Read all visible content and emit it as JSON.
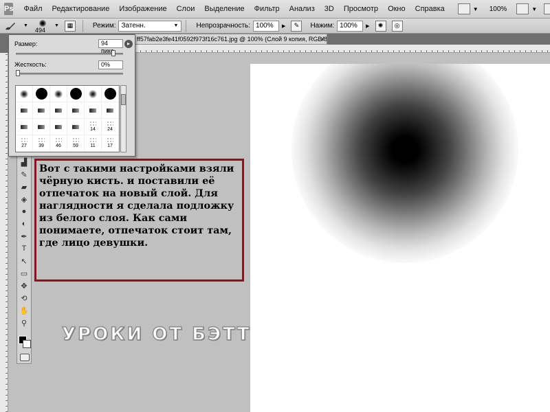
{
  "menubar": {
    "logo": "Ps",
    "items": [
      "Файл",
      "Редактирование",
      "Изображение",
      "Слои",
      "Выделение",
      "Фильтр",
      "Анализ",
      "3D",
      "Просмотр",
      "Окно",
      "Справка"
    ],
    "zoom_1": "100%",
    "zoom_2": "100%"
  },
  "options": {
    "brush_size": "494",
    "mode_label": "Режим:",
    "mode_value": "Затенн.",
    "opacity_label": "Непрозрачность:",
    "opacity_value": "100%",
    "flow_label": "Нажим:",
    "flow_value": "100%"
  },
  "document": {
    "tab_title": "ff57fab2e3fe41f0592f973f16c761.jpg @ 100% (Слой 9 копия, RGB/8)",
    "tab_close": "×"
  },
  "brush_popup": {
    "size_label": "Размер:",
    "size_value": "94 пикс.",
    "size_fraction": 0.94,
    "hardness_label": "Жесткость:",
    "hardness_value": "0%",
    "hardness_fraction": 0.0,
    "presets": [
      {
        "kind": "soft",
        "label": ""
      },
      {
        "kind": "hard",
        "label": ""
      },
      {
        "kind": "soft",
        "label": ""
      },
      {
        "kind": "hard",
        "label": ""
      },
      {
        "kind": "soft",
        "label": ""
      },
      {
        "kind": "hard",
        "label": ""
      },
      {
        "kind": "small",
        "label": ""
      },
      {
        "kind": "small",
        "label": ""
      },
      {
        "kind": "small",
        "label": ""
      },
      {
        "kind": "small",
        "label": ""
      },
      {
        "kind": "small",
        "label": ""
      },
      {
        "kind": "small",
        "label": ""
      },
      {
        "kind": "small",
        "label": ""
      },
      {
        "kind": "small",
        "label": ""
      },
      {
        "kind": "small",
        "label": ""
      },
      {
        "kind": "small",
        "label": ""
      },
      {
        "kind": "splat",
        "label": "14"
      },
      {
        "kind": "splat",
        "label": "24"
      },
      {
        "kind": "splat",
        "label": "27"
      },
      {
        "kind": "splat",
        "label": "39"
      },
      {
        "kind": "splat",
        "label": "46"
      },
      {
        "kind": "splat",
        "label": "59"
      },
      {
        "kind": "splat",
        "label": "11"
      },
      {
        "kind": "splat",
        "label": "17"
      }
    ]
  },
  "toolbox": {
    "tools": [
      "stamp-tool",
      "history-brush-tool",
      "eraser-tool",
      "paint-bucket-tool",
      "blur-tool",
      "dodge-tool",
      "pen-tool",
      "type-tool",
      "path-select-tool",
      "shape-tool",
      "3d-rotate-tool",
      "3d-orbit-tool",
      "hand-tool",
      "zoom-tool"
    ],
    "tool_glyphs": [
      "▟",
      "✎",
      "▰",
      "◈",
      "●",
      "◐",
      "✒",
      "T",
      "↖",
      "▭",
      "✥",
      "⟲",
      "✋",
      "⚲"
    ],
    "foreground": "#000000",
    "background": "#ffffff"
  },
  "note": {
    "text": "Вот с такими настройками взяли чёрную кисть. и поставили её отпечаток на новый слой. Для наглядности я сделала подложку из белого слоя. Как сами понимаете, отпечаток стоит там, где лицо девушки.",
    "border_color": "#7a1b24"
  },
  "watermark": {
    "text": "УРОКИ ОТ БЭТТ"
  }
}
